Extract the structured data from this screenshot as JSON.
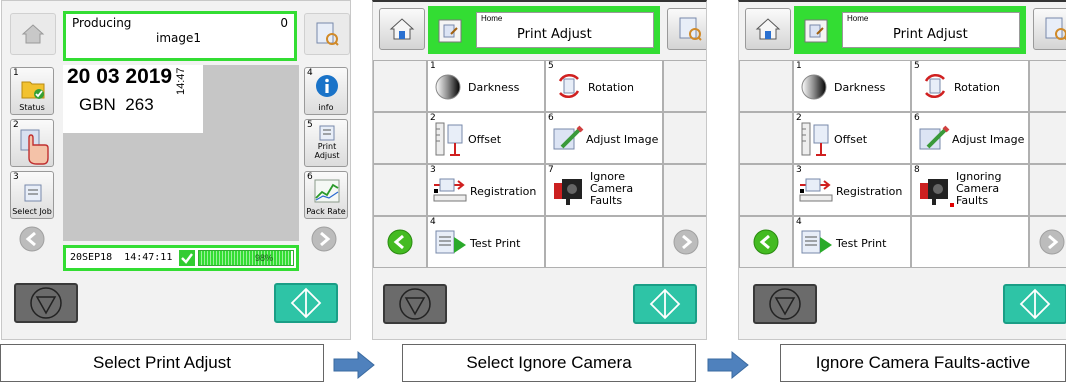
{
  "panel1": {
    "status_title": "Producing",
    "status_count": "0",
    "status_image": "image1",
    "preview_date": "20 03 2019",
    "preview_code": "GBN  263",
    "preview_time": "14:47",
    "left_buttons": [
      {
        "num": "1",
        "label": "Status",
        "icon": "folder-check-icon"
      },
      {
        "num": "2",
        "label": "",
        "icon": "hand-pointer-icon"
      },
      {
        "num": "3",
        "label": "Select Job",
        "icon": "select-job-icon"
      }
    ],
    "right_buttons": [
      {
        "num": "4",
        "label": "info",
        "icon": "info-icon"
      },
      {
        "num": "5",
        "label": "Print Adjust",
        "icon": "print-adjust-icon"
      },
      {
        "num": "6",
        "label": "Pack Rate",
        "icon": "pack-rate-chart-icon"
      }
    ],
    "date_status": "20SEP18  14:47:11",
    "progress_text": "98%",
    "progress_value": 0.98
  },
  "panel2": {
    "header_home": "Home",
    "header_title": "Print Adjust",
    "items": [
      {
        "num": "1",
        "label": "Darkness",
        "icon": "darkness-icon"
      },
      {
        "num": "5",
        "label": "Rotation",
        "icon": "rotation-icon"
      },
      {
        "num": "2",
        "label": "Offset",
        "icon": "offset-icon"
      },
      {
        "num": "6",
        "label": "Adjust Image",
        "icon": "adjust-image-icon"
      },
      {
        "num": "3",
        "label": "Registration",
        "icon": "registration-icon"
      },
      {
        "num": "7",
        "label": "Ignore Camera Faults",
        "icon": "camera-icon"
      },
      {
        "num": "4",
        "label": "Test Print",
        "icon": "test-print-icon"
      }
    ]
  },
  "panel3": {
    "header_home": "Home",
    "header_title": "Print Adjust",
    "items": [
      {
        "num": "1",
        "label": "Darkness",
        "icon": "darkness-icon"
      },
      {
        "num": "5",
        "label": "Rotation",
        "icon": "rotation-icon"
      },
      {
        "num": "2",
        "label": "Offset",
        "icon": "offset-icon"
      },
      {
        "num": "6",
        "label": "Adjust Image",
        "icon": "adjust-image-icon"
      },
      {
        "num": "3",
        "label": "Registration",
        "icon": "registration-icon"
      },
      {
        "num": "8",
        "label": "Ignoring Camera Faults",
        "icon": "camera-icon"
      },
      {
        "num": "4",
        "label": "Test Print",
        "icon": "test-print-icon"
      }
    ]
  },
  "captions": [
    "Select Print Adjust",
    "Select Ignore Camera",
    "Ignore Camera Faults-active"
  ],
  "colors": {
    "highlight_green": "#33dd33",
    "start_teal": "#2ec4a6",
    "stop_gray": "#6b6b6b",
    "arrow_blue": "#4f81bd"
  }
}
